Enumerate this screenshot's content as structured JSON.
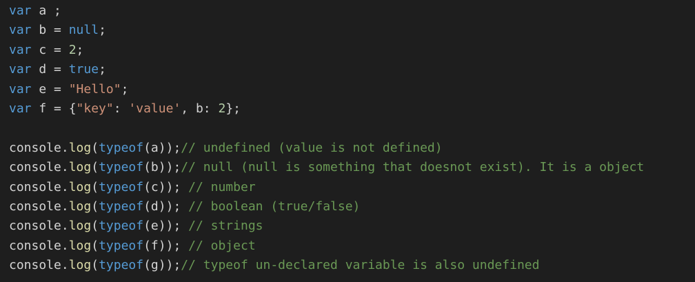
{
  "code_lines": [
    {
      "id": 1,
      "tokens": [
        {
          "t": "kw",
          "v": "var"
        },
        {
          "t": "var",
          "v": " a ;"
        }
      ]
    },
    {
      "id": 2,
      "tokens": [
        {
          "t": "kw",
          "v": "var"
        },
        {
          "t": "var",
          "v": " b = "
        },
        {
          "t": "null",
          "v": "null"
        },
        {
          "t": "op",
          "v": ";"
        }
      ]
    },
    {
      "id": 3,
      "tokens": [
        {
          "t": "kw",
          "v": "var"
        },
        {
          "t": "var",
          "v": " c = "
        },
        {
          "t": "num",
          "v": "2"
        },
        {
          "t": "op",
          "v": ";"
        }
      ]
    },
    {
      "id": 4,
      "tokens": [
        {
          "t": "kw",
          "v": "var"
        },
        {
          "t": "var",
          "v": " d = "
        },
        {
          "t": "bool",
          "v": "true"
        },
        {
          "t": "op",
          "v": ";"
        }
      ]
    },
    {
      "id": 5,
      "tokens": [
        {
          "t": "kw",
          "v": "var"
        },
        {
          "t": "var",
          "v": " e = "
        },
        {
          "t": "str",
          "v": "\"Hello\""
        },
        {
          "t": "op",
          "v": ";"
        }
      ]
    },
    {
      "id": 6,
      "tokens": [
        {
          "t": "kw",
          "v": "var"
        },
        {
          "t": "var",
          "v": " f = {"
        },
        {
          "t": "str",
          "v": "\"key\""
        },
        {
          "t": "op",
          "v": ": "
        },
        {
          "t": "str",
          "v": "'value'"
        },
        {
          "t": "op",
          "v": ", b: "
        },
        {
          "t": "num",
          "v": "2"
        },
        {
          "t": "op",
          "v": "};"
        }
      ]
    },
    {
      "id": 7,
      "tokens": []
    },
    {
      "id": 8,
      "tokens": [
        {
          "t": "var",
          "v": "console."
        },
        {
          "t": "func",
          "v": "log"
        },
        {
          "t": "op",
          "v": "("
        },
        {
          "t": "typeof",
          "v": "typeof"
        },
        {
          "t": "op",
          "v": "(a));"
        },
        {
          "t": "comment",
          "v": "// undefined (value is not defined)"
        }
      ]
    },
    {
      "id": 9,
      "tokens": [
        {
          "t": "var",
          "v": "console."
        },
        {
          "t": "func",
          "v": "log"
        },
        {
          "t": "op",
          "v": "("
        },
        {
          "t": "typeof",
          "v": "typeof"
        },
        {
          "t": "op",
          "v": "(b));"
        },
        {
          "t": "comment",
          "v": "// null (null is something that doesnot exist). It is a object"
        }
      ]
    },
    {
      "id": 10,
      "tokens": [
        {
          "t": "var",
          "v": "console."
        },
        {
          "t": "func",
          "v": "log"
        },
        {
          "t": "op",
          "v": "("
        },
        {
          "t": "typeof",
          "v": "typeof"
        },
        {
          "t": "op",
          "v": "(c)); "
        },
        {
          "t": "comment",
          "v": "// number"
        }
      ]
    },
    {
      "id": 11,
      "tokens": [
        {
          "t": "var",
          "v": "console."
        },
        {
          "t": "func",
          "v": "log"
        },
        {
          "t": "op",
          "v": "("
        },
        {
          "t": "typeof",
          "v": "typeof"
        },
        {
          "t": "op",
          "v": "(d)); "
        },
        {
          "t": "comment",
          "v": "// boolean (true/false)"
        }
      ]
    },
    {
      "id": 12,
      "tokens": [
        {
          "t": "var",
          "v": "console."
        },
        {
          "t": "func",
          "v": "log"
        },
        {
          "t": "op",
          "v": "("
        },
        {
          "t": "typeof",
          "v": "typeof"
        },
        {
          "t": "op",
          "v": "(e)); "
        },
        {
          "t": "comment",
          "v": "// strings"
        }
      ]
    },
    {
      "id": 13,
      "tokens": [
        {
          "t": "var",
          "v": "console."
        },
        {
          "t": "func",
          "v": "log"
        },
        {
          "t": "op",
          "v": "("
        },
        {
          "t": "typeof",
          "v": "typeof"
        },
        {
          "t": "op",
          "v": "(f)); "
        },
        {
          "t": "comment",
          "v": "// object"
        }
      ]
    },
    {
      "id": 14,
      "tokens": [
        {
          "t": "var",
          "v": "console."
        },
        {
          "t": "func",
          "v": "log"
        },
        {
          "t": "op",
          "v": "("
        },
        {
          "t": "typeof",
          "v": "typeof"
        },
        {
          "t": "op",
          "v": "(g));"
        },
        {
          "t": "comment",
          "v": "// typeof un-declared variable is also undefined"
        }
      ]
    }
  ],
  "theme": {
    "background": "#1e1e1e",
    "keyword": "#569cd6",
    "string": "#ce9178",
    "number": "#b5cea8",
    "function": "#dcdcaa",
    "comment": "#6a9955",
    "default": "#d4d4d4"
  }
}
